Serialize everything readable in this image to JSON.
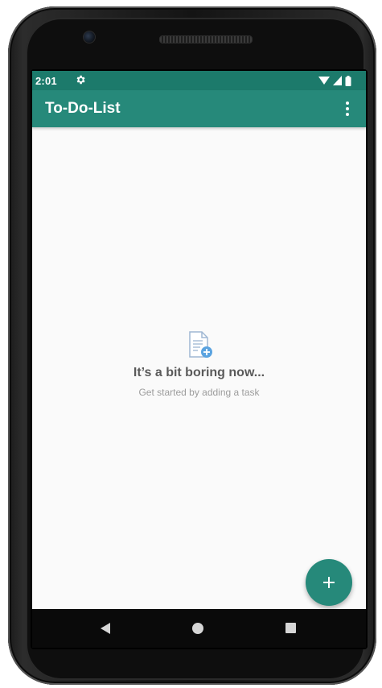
{
  "status_bar": {
    "time": "2:01",
    "color": "#1c7a6b",
    "icons": [
      "settings-gear-icon",
      "wifi-icon",
      "cellular-signal-icon",
      "battery-icon"
    ]
  },
  "app_bar": {
    "title": "To-Do-List",
    "color": "#26897a",
    "menu_icon": "overflow-menu-icon"
  },
  "empty_state": {
    "icon": "add-document-icon",
    "title": "It’s a bit boring now...",
    "subtitle": "Get started by adding a task"
  },
  "fab": {
    "icon": "plus-icon",
    "color": "#26897a"
  },
  "navigation_bar": {
    "icons": [
      "back-icon",
      "home-icon",
      "recents-icon"
    ]
  }
}
